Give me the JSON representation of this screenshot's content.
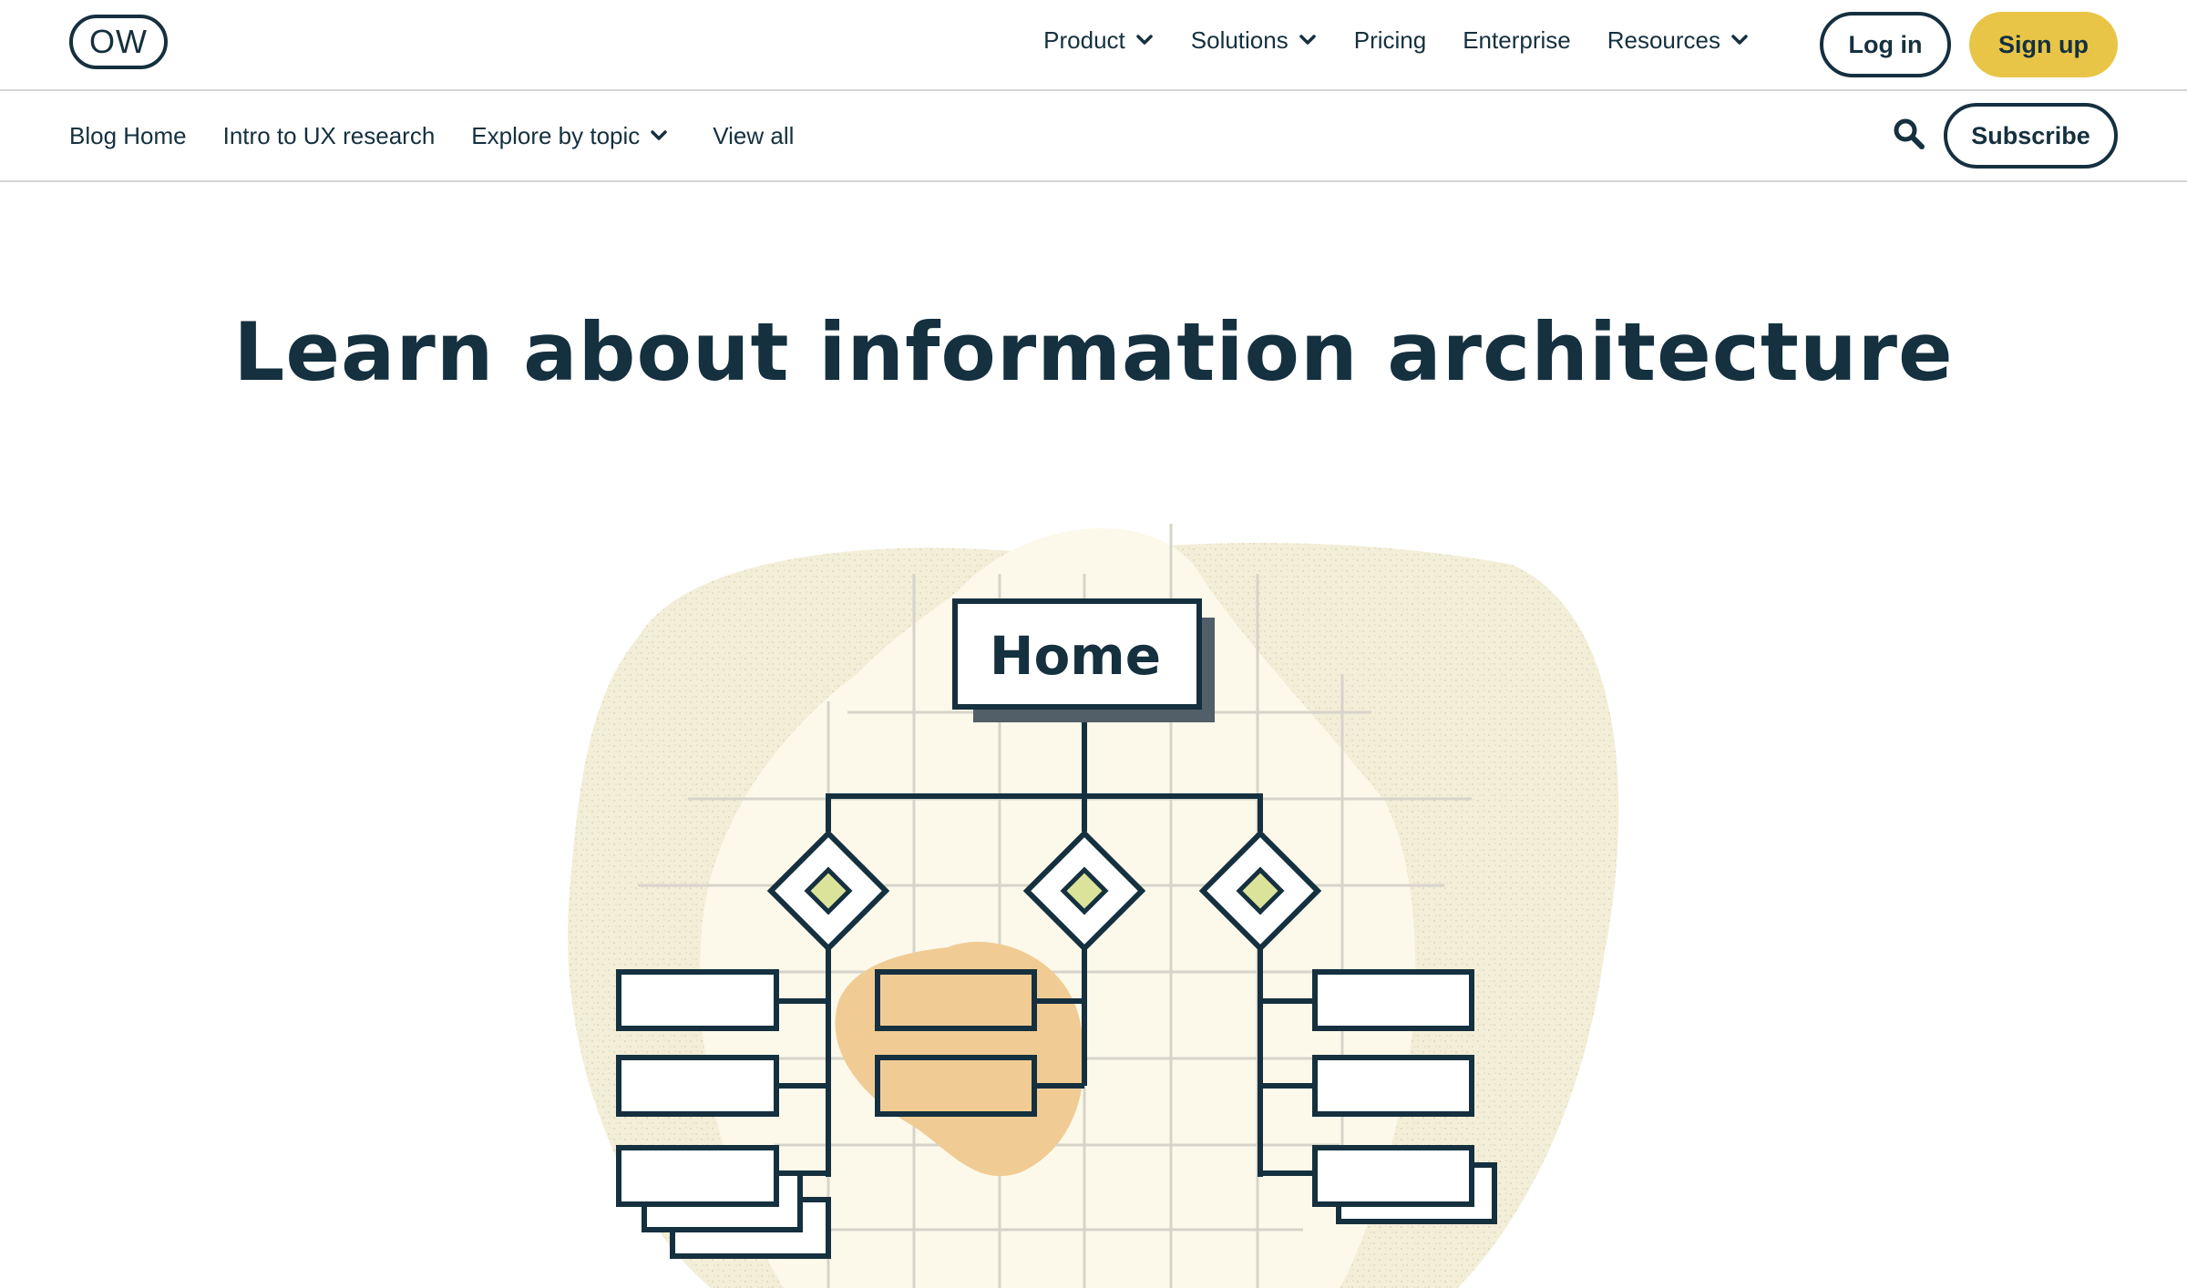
{
  "header": {
    "logo_text": "OW",
    "menu": [
      {
        "label": "Product",
        "has_dropdown": true
      },
      {
        "label": "Solutions",
        "has_dropdown": true
      },
      {
        "label": "Pricing",
        "has_dropdown": false
      },
      {
        "label": "Enterprise",
        "has_dropdown": false
      },
      {
        "label": "Resources",
        "has_dropdown": true
      }
    ],
    "login_label": "Log in",
    "signup_label": "Sign up"
  },
  "subnav": {
    "items": [
      {
        "label": "Blog Home"
      },
      {
        "label": "Intro to UX research"
      },
      {
        "label": "Explore by topic",
        "has_dropdown": true
      },
      {
        "label": "View all"
      }
    ],
    "search_icon": "search-icon",
    "subscribe_label": "Subscribe"
  },
  "page": {
    "title": "Learn about information architecture"
  },
  "illustration": {
    "home_label": "Home"
  },
  "colors": {
    "text": "#15303f",
    "accent": "#e8c547",
    "blob": "#f1ebd2",
    "highlight": "#f0cc94",
    "diamond_fill": "#dbe39a"
  }
}
